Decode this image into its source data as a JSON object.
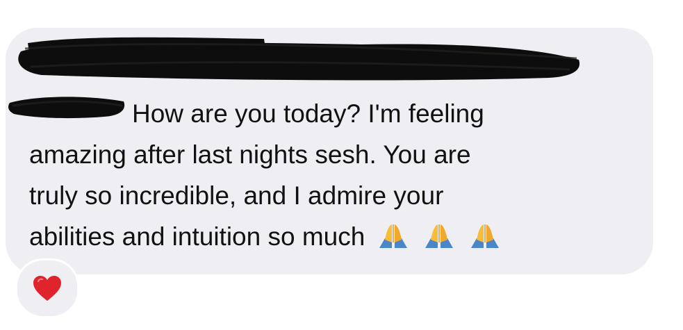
{
  "message": {
    "line1": "How are you today? I'm feeling",
    "line2": "amazing after last nights sesh. You are",
    "line3": "truly so incredible, and I admire your",
    "line4": "abilities and intuition so much"
  },
  "emojis": [
    "folded-hands",
    "folded-hands",
    "folded-hands"
  ],
  "reaction": {
    "icon": "heart",
    "color": "#e0242b"
  },
  "colors": {
    "bubble": "#efeff3",
    "text": "#111111",
    "redaction": "#0d0d0d"
  }
}
